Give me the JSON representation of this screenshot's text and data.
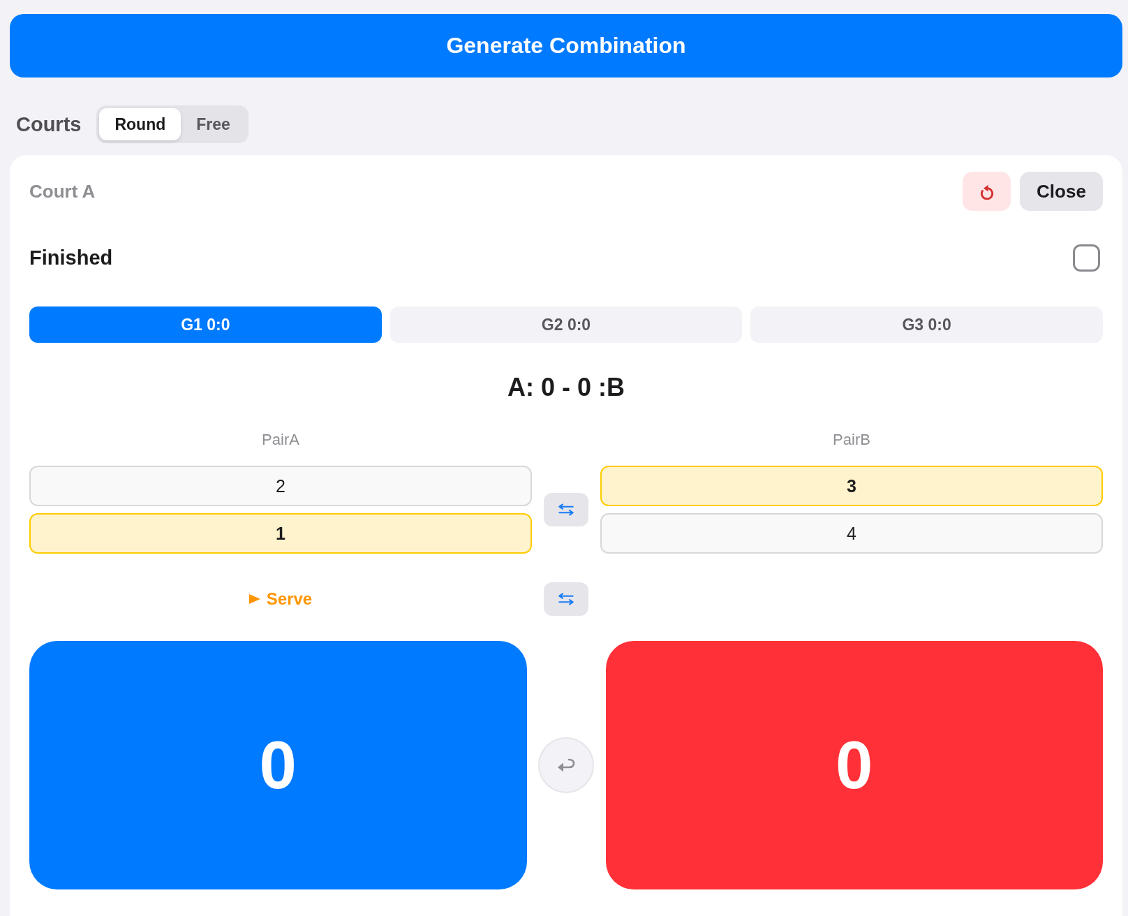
{
  "generate_button": {
    "label": "Generate Combination"
  },
  "courts": {
    "title": "Courts",
    "modes": [
      {
        "label": "Round",
        "selected": true
      },
      {
        "label": "Free",
        "selected": false
      }
    ]
  },
  "court": {
    "name": "Court A",
    "close_button": "Close",
    "finished": {
      "label": "Finished",
      "checked": false
    },
    "games": [
      {
        "label": "G1 0:0",
        "selected": true
      },
      {
        "label": "G2 0:0",
        "selected": false
      },
      {
        "label": "G3 0:0",
        "selected": false
      }
    ],
    "score_line": "A: 0 - 0 :B",
    "pairs": [
      {
        "label": "PairA",
        "serving": true,
        "players": [
          {
            "name": "2",
            "highlighted": false
          },
          {
            "name": "1",
            "highlighted": true
          }
        ]
      },
      {
        "label": "PairB",
        "serving": false,
        "players": [
          {
            "name": "3",
            "highlighted": true
          },
          {
            "name": "4",
            "highlighted": false
          }
        ]
      }
    ],
    "serve_label": "Serve",
    "scores": [
      {
        "value": "0",
        "color": "#007aff"
      },
      {
        "value": "0",
        "color": "#ff3037"
      }
    ]
  }
}
